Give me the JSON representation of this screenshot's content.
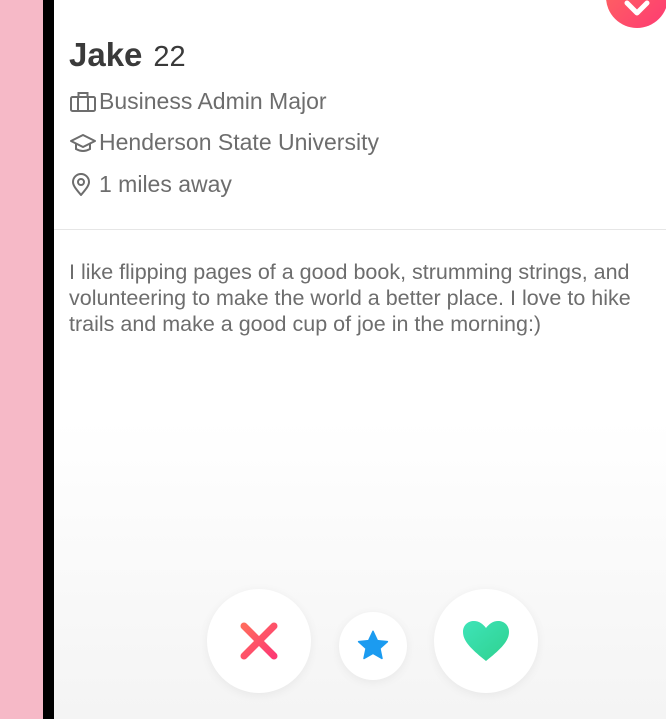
{
  "profile": {
    "name": "Jake",
    "age": "22",
    "job": "Business Admin Major",
    "school": "Henderson State University",
    "distance": "1 miles away",
    "bio": "I like flipping pages of a good book, strumming strings, and volunteering to make the world a better place. I love to hike trails and make a good cup of joe in the morning:)"
  },
  "icons": {
    "job": "briefcase-icon",
    "school": "graduation-cap-icon",
    "distance": "location-pin-icon",
    "nope": "x-icon",
    "super_like": "star-icon",
    "like": "heart-icon",
    "collapse": "chevron-down-icon"
  },
  "colors": {
    "side_background": "#f6b9c7",
    "text_primary": "#3a3a3a",
    "text_secondary": "#6d6d6d",
    "nope_gradient": [
      "#ff6a5e",
      "#fd3a73"
    ],
    "super_like": "#1b9bf0",
    "like_gradient": [
      "#3ee4b8",
      "#2fd18f"
    ]
  }
}
